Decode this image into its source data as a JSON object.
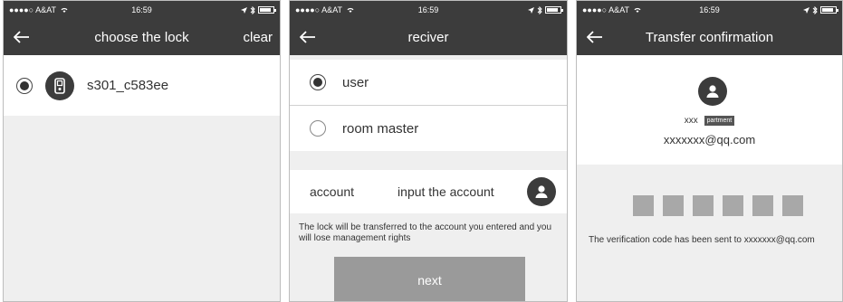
{
  "status": {
    "carrier": "●●●●○ A&AT",
    "wifi": "wifi-icon",
    "time": "16:59",
    "icons": [
      "location-arrow-icon",
      "bluetooth-icon",
      "battery-icon"
    ]
  },
  "screen1": {
    "title": "choose the lock",
    "clear": "clear",
    "lock": {
      "name": "s301_c583ee",
      "selected": true,
      "icon": "lock-icon"
    }
  },
  "screen2": {
    "title": "reciver",
    "options": [
      {
        "label": "user",
        "selected": true
      },
      {
        "label": "room master",
        "selected": false
      }
    ],
    "account_label": "account",
    "account_placeholder": "input the account",
    "note": "The lock will be transferred to the account you entered and you will lose management rights",
    "next": "next"
  },
  "screen3": {
    "title": "Transfer confirmation",
    "name": "xxx",
    "badge": "partment",
    "email": "xxxxxxx@qq.com",
    "code_boxes": 6,
    "sent": "The verification code has been sent to xxxxxxx@qq.com"
  },
  "colors": {
    "bar": "#3c3c3c",
    "background": "#efefef",
    "button": "#9a9a9a",
    "code_box": "#a8a8a8"
  }
}
